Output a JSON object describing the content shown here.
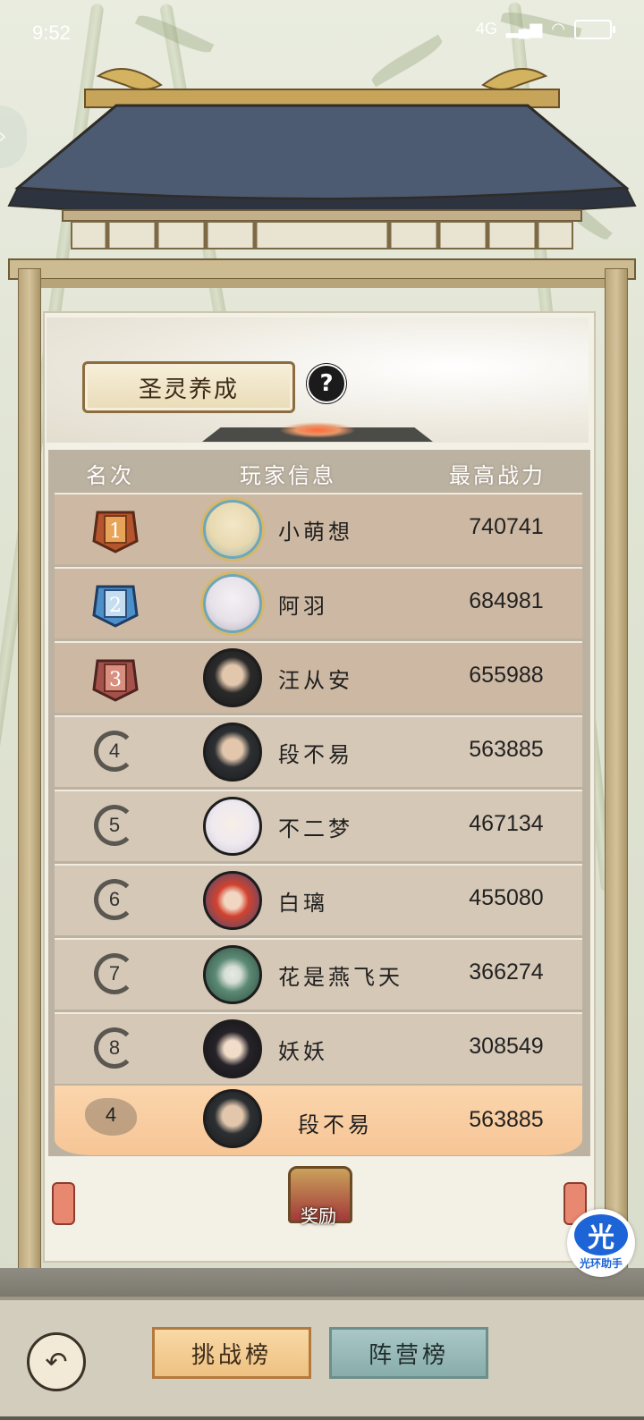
{
  "status_bar": {
    "time": "9:52",
    "network": "4G",
    "signal": "all",
    "wifi": "wifi-icon",
    "battery": "battery-icon"
  },
  "header": {
    "title": "圣灵养成",
    "help": "?"
  },
  "table": {
    "columns": {
      "rank": "名次",
      "player": "玩家信息",
      "power": "最高战力"
    },
    "rows": [
      {
        "rank": "1",
        "name": "小萌想",
        "power": "740741",
        "badge_color": "#b5552e",
        "avatar_color": "#e8d9b0"
      },
      {
        "rank": "2",
        "name": "阿羽",
        "power": "684981",
        "badge_color": "#4d8fc9",
        "avatar_color": "#e6e1e8"
      },
      {
        "rank": "3",
        "name": "汪从安",
        "power": "655988",
        "badge_color": "#a5524a",
        "avatar_color": "#2b2a2a"
      },
      {
        "rank": "4",
        "name": "段不易",
        "power": "563885",
        "avatar_color": "#2d3033"
      },
      {
        "rank": "5",
        "name": "不二梦",
        "power": "467134",
        "avatar_color": "#efeaf0"
      },
      {
        "rank": "6",
        "name": "白璃",
        "power": "455080",
        "avatar_color": "#d2422f"
      },
      {
        "rank": "7",
        "name": "花是燕飞天",
        "power": "366274",
        "avatar_color": "#5c8a74"
      },
      {
        "rank": "8",
        "name": "妖妖",
        "power": "308549",
        "avatar_color": "#262329"
      }
    ],
    "my_row": {
      "rank": "4",
      "name": "段不易",
      "power": "563885"
    }
  },
  "reward": {
    "label": "奖励"
  },
  "bottom": {
    "back_icon": "back-arrow-icon",
    "tab_challenge": "挑战榜",
    "tab_camp": "阵营榜"
  },
  "assistant": {
    "glyph": "光",
    "label": "光环助手"
  }
}
